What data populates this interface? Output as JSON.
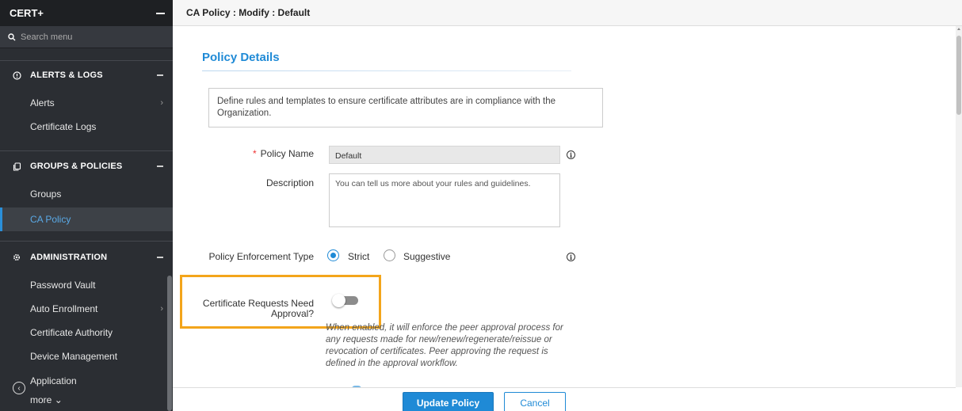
{
  "sidebar": {
    "brand": "CERT+",
    "search_placeholder": "Search menu",
    "sections": [
      {
        "label": "ALERTS & LOGS",
        "icon": "alert-circle-icon",
        "items": [
          {
            "label": "Alerts",
            "has_children": true
          },
          {
            "label": "Certificate Logs",
            "has_children": false
          }
        ]
      },
      {
        "label": "GROUPS & POLICIES",
        "icon": "copy-icon",
        "items": [
          {
            "label": "Groups",
            "has_children": false
          },
          {
            "label": "CA Policy",
            "has_children": false,
            "active": true
          }
        ]
      },
      {
        "label": "ADMINISTRATION",
        "icon": "gear-icon",
        "items": [
          {
            "label": "Password Vault",
            "has_children": false
          },
          {
            "label": "Auto Enrollment",
            "has_children": true
          },
          {
            "label": "Certificate Authority",
            "has_children": false
          },
          {
            "label": "Device Management",
            "has_children": false
          },
          {
            "label": "Application",
            "has_children": false
          }
        ]
      }
    ],
    "more_label": "more"
  },
  "header": {
    "breadcrumb": "CA Policy : Modify : Default"
  },
  "form": {
    "section_title": "Policy Details",
    "intro": "Define rules and templates to ensure certificate attributes are in compliance with the Organization.",
    "policy_name_label": "Policy Name",
    "policy_name_value": "Default",
    "description_label": "Description",
    "description_value": "You can tell us more about your rules and guidelines.",
    "enforcement_label": "Policy Enforcement Type",
    "enforcement_options": [
      "Strict",
      "Suggestive"
    ],
    "enforcement_selected": "Strict",
    "approval_label_line1": "Certificate Requests Need",
    "approval_label_line2": "Approval?",
    "approval_enabled": false,
    "approval_help": "When enabled, it will enforce the peer approval process for any requests made for new/renew/regenerate/reissue or revocation of certificates. Peer approving the request is defined in the approval workflow."
  },
  "footer": {
    "update_label": "Update Policy",
    "cancel_label": "Cancel"
  },
  "colors": {
    "accent": "#1f8ad6",
    "highlight": "#f3a51b",
    "sidebar_bg": "#2b2e33"
  }
}
